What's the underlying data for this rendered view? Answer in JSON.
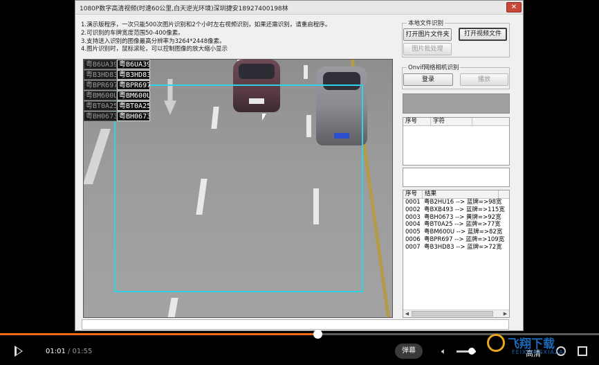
{
  "window": {
    "title": "1080P数字高清视频(时速60公里,白天逆光环境)深圳捷安18927400198林",
    "close_symbol": "✕"
  },
  "instructions": [
    "1.演示版程序，一次只能500次图片识别和2个小时左右视频识别，如果还需识别，请重启程序。",
    "2.可识别的车牌宽度范围50-400像素。",
    "3.支持送入识别的图像最高分辨率为3264*2448像素。",
    "4.图片识别时，鼠标滚轮，可以控制图像的放大缩小显示"
  ],
  "plates_overlay": [
    {
      "dim": "粤B6UA39",
      "bright": "粤B6UA39"
    },
    {
      "dim": "粤B3HD83",
      "bright": "粤B3HD83"
    },
    {
      "dim": "粤BPR697",
      "bright": "粤BPR697"
    },
    {
      "dim": "粤BM600U",
      "bright": "粤BM600U"
    },
    {
      "dim": "粤BT0A25",
      "bright": "粤BT0A25"
    },
    {
      "dim": "粤BH0673",
      "bright": "粤BH0673"
    }
  ],
  "local_file": {
    "legend": "本地文件识别",
    "open_image_folder": "打开图片文件夹",
    "open_video_file": "打开视频文件",
    "batch_process": "图片批处理"
  },
  "onvif": {
    "legend": "Onvif网络相机识别",
    "login": "登录",
    "play": "播放"
  },
  "char_list": {
    "headers": [
      "序号",
      "字符"
    ]
  },
  "results": {
    "headers": [
      "序号",
      "结果"
    ],
    "rows": [
      {
        "no": "0001",
        "text": "粤B2HU16 --> 蓝牌=>98宽"
      },
      {
        "no": "0002",
        "text": "粤BXB493 --> 蓝牌=>115宽"
      },
      {
        "no": "0003",
        "text": "粤BH0673 --> 黄牌=>92宽"
      },
      {
        "no": "0004",
        "text": "粤BT0A25 --> 蓝牌=>77宽"
      },
      {
        "no": "0005",
        "text": "粤BM600U --> 蓝牌=>82宽"
      },
      {
        "no": "0006",
        "text": "粤BPR697 --> 蓝牌=>109宽"
      },
      {
        "no": "0007",
        "text": "粤B3HD83 --> 蓝牌=>72宽"
      }
    ]
  },
  "player": {
    "current_time": "01:01",
    "duration": "/ 01:55",
    "progress": 0.53,
    "volume": 0.8,
    "danmu_label": "弹幕",
    "quality_label": "高清"
  },
  "watermark": {
    "text": "飞翔下载",
    "sub": "FEIXIANGXIAZAI"
  },
  "colors": {
    "accent": "#f06a18",
    "roi": "#2fd4e8",
    "watermark": "#1e72c8"
  }
}
